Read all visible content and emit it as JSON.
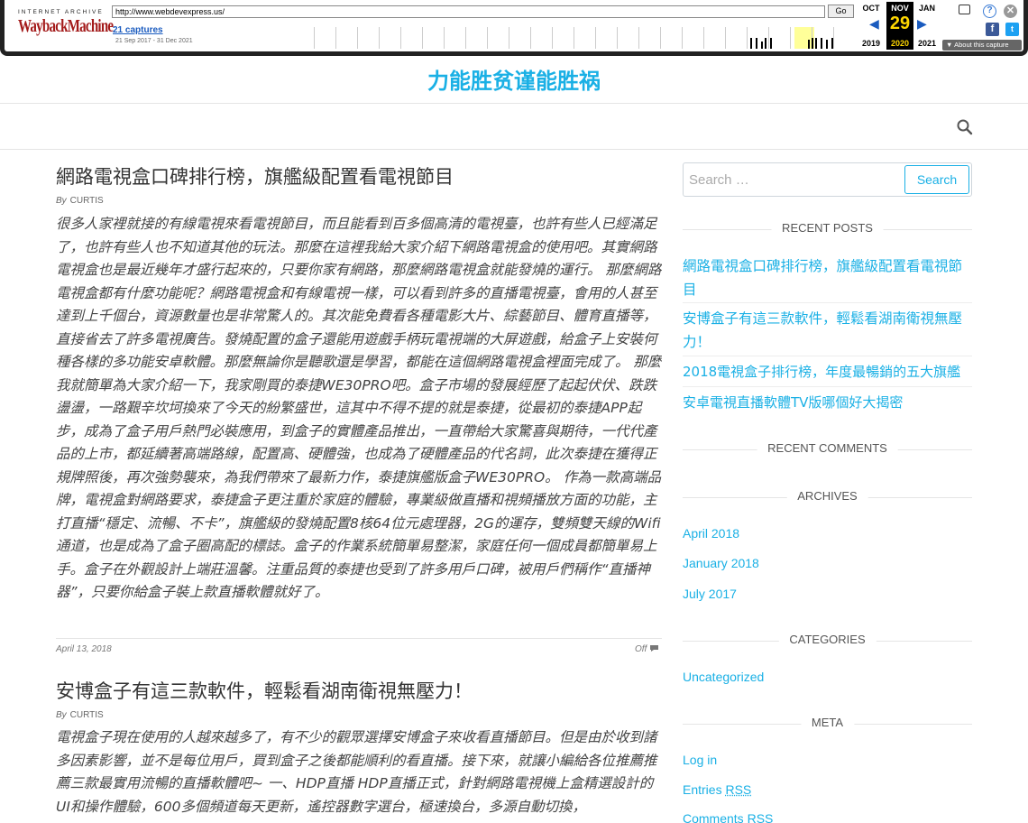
{
  "wayback": {
    "ia_label": "INTERNET ARCHIVE",
    "logo": "WaybackMachine",
    "url": "http://www.webdevexpress.us/",
    "go_label": "Go",
    "captures": "21 captures",
    "range": "21 Sep 2017 - 31 Dec 2021",
    "months": {
      "prev": "OCT",
      "cur": "NOV",
      "next": "JAN"
    },
    "day": "29",
    "years": {
      "prev": "2019",
      "cur": "2020",
      "next": "2021"
    },
    "about": "About this capture",
    "icons": [
      "window-icon",
      "help-icon",
      "close-icon",
      "facebook-icon",
      "twitter-icon"
    ]
  },
  "site": {
    "title": "力能胜贫谨能胜祸"
  },
  "posts": [
    {
      "title": "網路電視盒口碑排行榜，旗艦級配置看電視節目",
      "by": "By",
      "author": "CURTIS",
      "body": "很多人家裡就接的有線電視來看電視節目，而且能看到百多個高清的電視臺，也許有些人已經滿足了，也許有些人也不知道其他的玩法。那麼在這裡我給大家介紹下網路電視盒的使用吧。其實網路電視盒也是最近幾年才盛行起來的，只要你家有網路，那麼網路電視盒就能發燒的運行。 那麼網路電視盒都有什麼功能呢？網路電視盒和有線電視一樣，可以看到許多的直播電視臺，會用的人甚至達到上千個台，資源數量也是非常驚人的。其次能免費看各種電影大片、綜藝節目、體育直播等，直接省去了許多電視廣告。發燒配置的盒子還能用遊戲手柄玩電視端的大屏遊戲，給盒子上安裝何種各樣的多功能安卓軟體。那麼無論你是聽歌還是學習，都能在這個網路電視盒裡面完成了。 那麼我就簡單為大家介紹一下，我家剛買的泰捷WE30PRO吧。盒子市場的發展經歷了起起伏伏、跌跌盪盪，一路艱辛坎坷換來了今天的紛繁盛世，這其中不得不提的就是泰捷，從最初的泰捷APP起步，成為了盒子用戶熱門必裝應用，到盒子的實體產品推出，一直帶給大家驚喜與期待，一代代產品的上市，都延續著高端路線，配置高、硬體強，也成為了硬體產品的代名詞，此次泰捷在獲得正規牌照後，再次強勢襲來，為我們帶來了最新力作，泰捷旗艦版盒子WE30PRO。 作為一款高端品牌，電視盒對網路要求，泰捷盒子更注重於家庭的體驗，專業級做直播和視頻播放方面的功能，主打直播“穩定、流暢、不卡”，旗艦級的發燒配置8核64位元處理器，2G的運存，雙頻雙天線的Wifi通道，也是成為了盒子圈高配的標誌。盒子的作業系統簡單易整潔，家庭任何一個成員都簡單易上手。盒子在外觀設計上端莊溫馨。注重品質的泰捷也受到了許多用戶口碑，被用戶們稱作“直播神器”，只要你給盒子裝上款直播軟體就好了。",
      "date": "April 13, 2018",
      "comments": "Off"
    },
    {
      "title": "安博盒子有這三款軟件，輕鬆看湖南衛視無壓力！",
      "by": "By",
      "author": "CURTIS",
      "body": "電視盒子現在使用的人越來越多了，有不少的觀眾選擇安博盒子來收看直播節目。但是由於收到諸多因素影響，並不是每位用戶，買到盒子之後都能順利的看直播。接下來，就讓小編給各位推薦推薦三款最實用流暢的直播軟體吧~ 一、HDP直播 HDP直播正式，針對網路電視機上盒精選設計的UI和操作體驗，600多個頻道每天更新，遙控器數字選台，極速換台，多源自動切換，"
    }
  ],
  "sidebar": {
    "search_placeholder": "Search …",
    "search_button": "Search",
    "recent_posts_title": "RECENT POSTS",
    "recent_posts": [
      "網路電視盒口碑排行榜，旗艦級配置看電視節目",
      "安博盒子有這三款軟件，輕鬆看湖南衛視無壓力！",
      "2018電視盒子排行榜，年度最暢銷的五大旗艦",
      "安卓電視直播軟體TV版哪個好大揭密"
    ],
    "recent_comments_title": "RECENT COMMENTS",
    "archives_title": "ARCHIVES",
    "archives": [
      "April 2018",
      "January 2018",
      "July 2017"
    ],
    "categories_title": "CATEGORIES",
    "categories": [
      "Uncategorized"
    ],
    "meta_title": "META",
    "meta": {
      "login": "Log in",
      "entries_prefix": "Entries",
      "comments_prefix": "Comments",
      "rss": "RSS"
    }
  }
}
